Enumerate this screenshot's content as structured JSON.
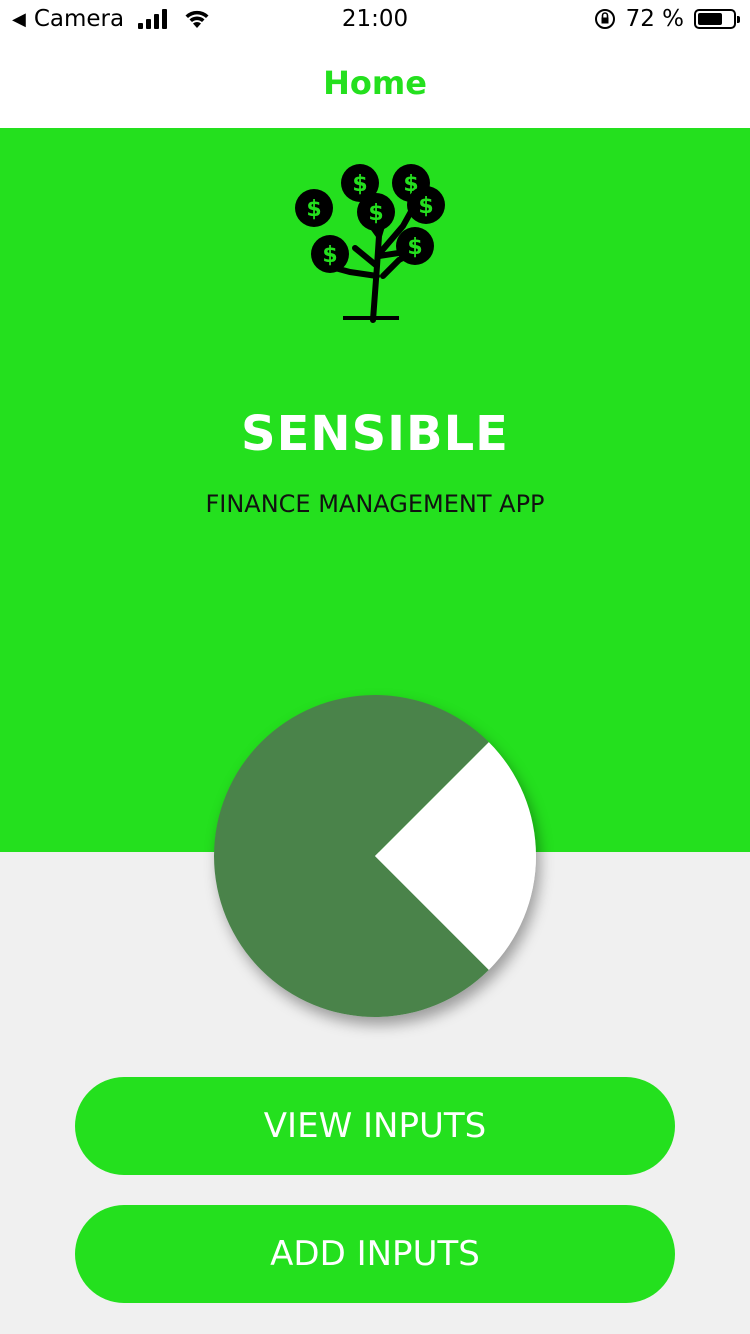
{
  "status_bar": {
    "back_app": "Camera",
    "time": "21:00",
    "battery_percent": "72 %",
    "battery_level": 0.72
  },
  "nav": {
    "title": "Home"
  },
  "hero": {
    "app_name": "SENSIBLE",
    "tagline": "FINANCE MANAGEMENT APP",
    "logo_symbol": "$"
  },
  "colors": {
    "brand_green": "#24e01e",
    "pie_dark_green": "#4a834a",
    "pie_white": "#ffffff",
    "background": "#f0f0f0"
  },
  "chart_data": {
    "type": "pie",
    "slices": [
      {
        "value": 75,
        "color": "#4a834a"
      },
      {
        "value": 25,
        "color": "#ffffff"
      }
    ]
  },
  "buttons": {
    "view_inputs": "VIEW INPUTS",
    "add_inputs": "ADD INPUTS"
  }
}
